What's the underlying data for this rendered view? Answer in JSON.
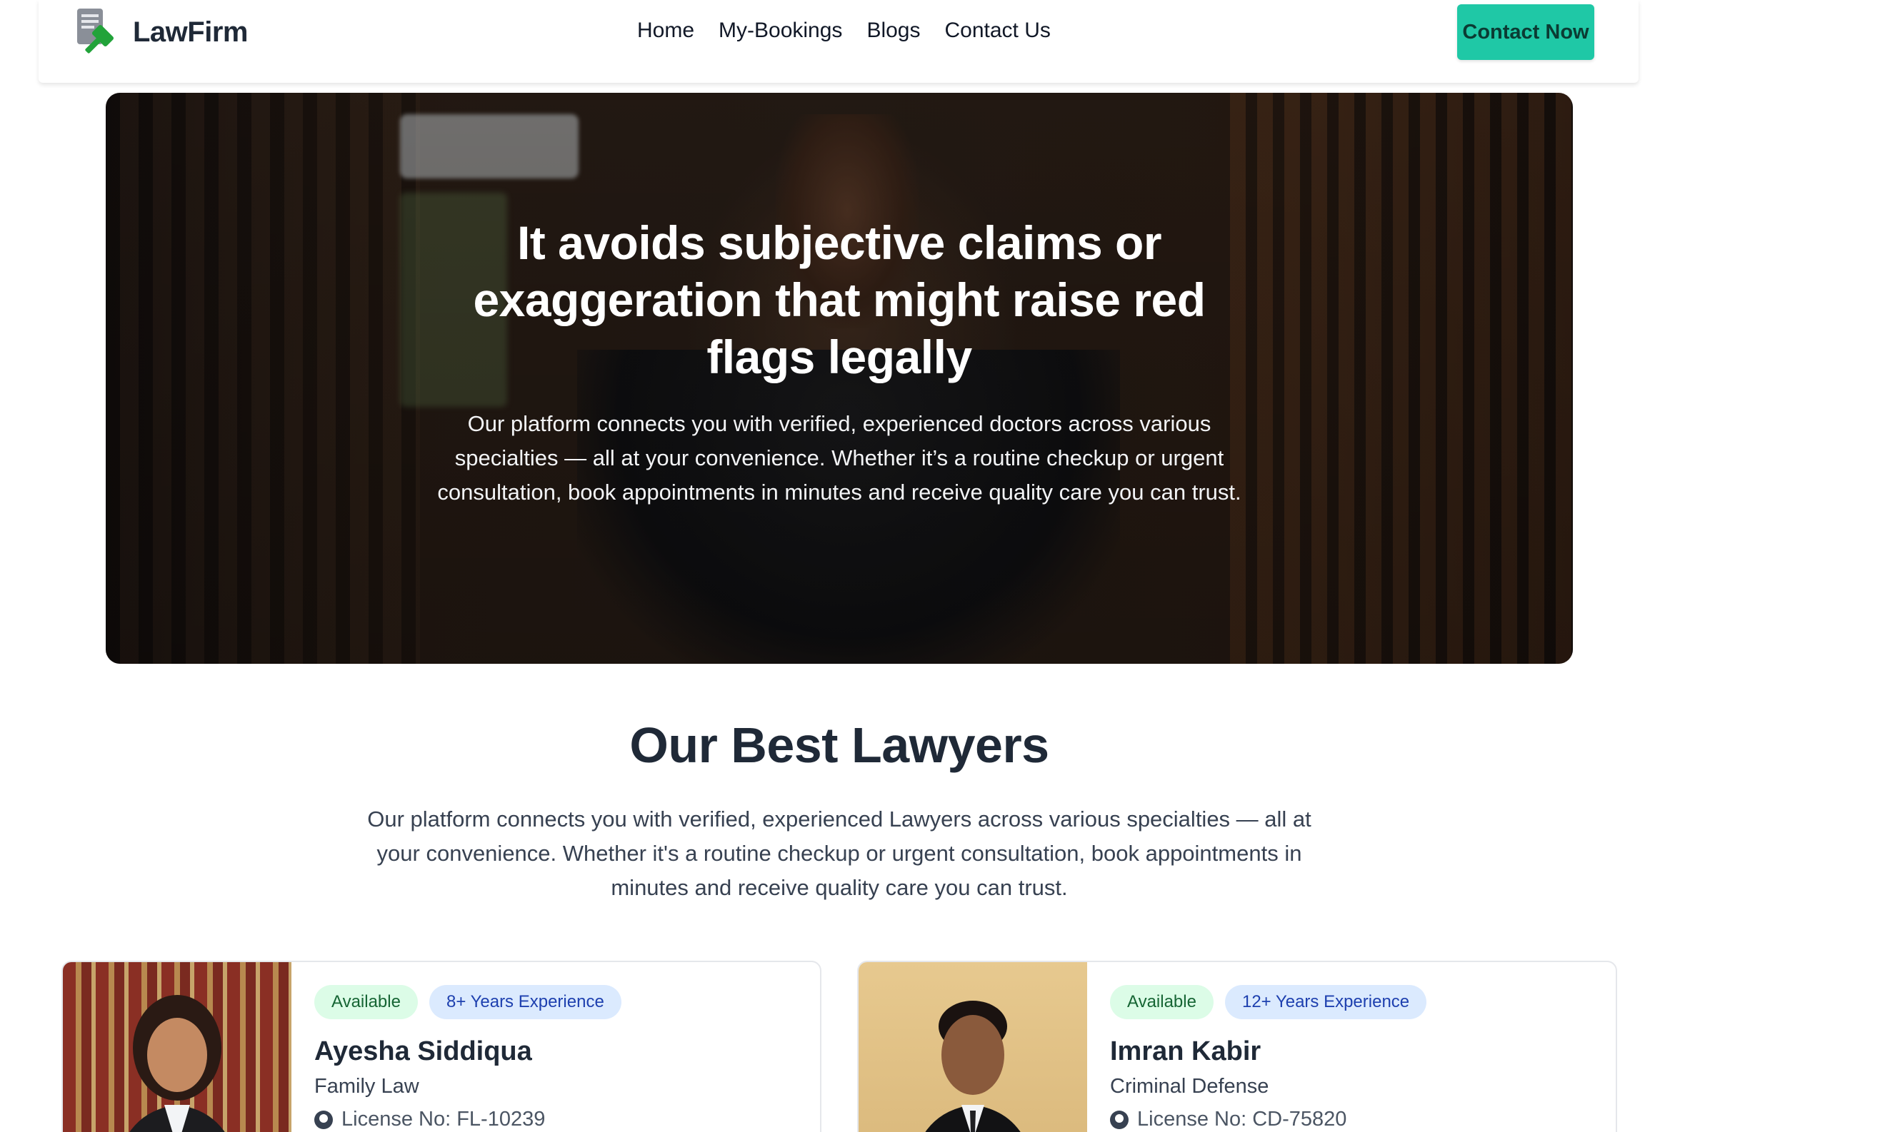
{
  "nav": {
    "brand": "LawFirm",
    "links": [
      "Home",
      "My-Bookings",
      "Blogs",
      "Contact Us"
    ],
    "cta_label": "Contact Now"
  },
  "hero": {
    "title": "It avoids subjective claims or exaggeration that might raise red flags legally",
    "text": "Our platform connects you with verified, experienced doctors across various specialties — all at your convenience. Whether it’s a routine checkup or urgent consultation, book appointments in minutes and receive quality care you can trust."
  },
  "lawyers_section": {
    "title": "Our Best Lawyers",
    "text": "Our platform connects you with verified, experienced Lawyers across various specialties — all at your convenience. Whether it's a routine checkup or urgent consultation, book appointments in minutes and receive quality care you can trust."
  },
  "lawyers": [
    {
      "status": "Available",
      "experience": "8+ Years Experience",
      "name": "Ayesha Siddiqua",
      "specialty": "Family Law",
      "license": "License No: FL-10239"
    },
    {
      "status": "Available",
      "experience": "12+ Years Experience",
      "name": "Imran Kabir",
      "specialty": "Criminal Defense",
      "license": "License No: CD-75820"
    }
  ],
  "colors": {
    "accent": "#1fc8a6",
    "available_bg": "#dcfce7",
    "experience_bg": "#dbeafe",
    "logo_green": "#22a33a"
  }
}
